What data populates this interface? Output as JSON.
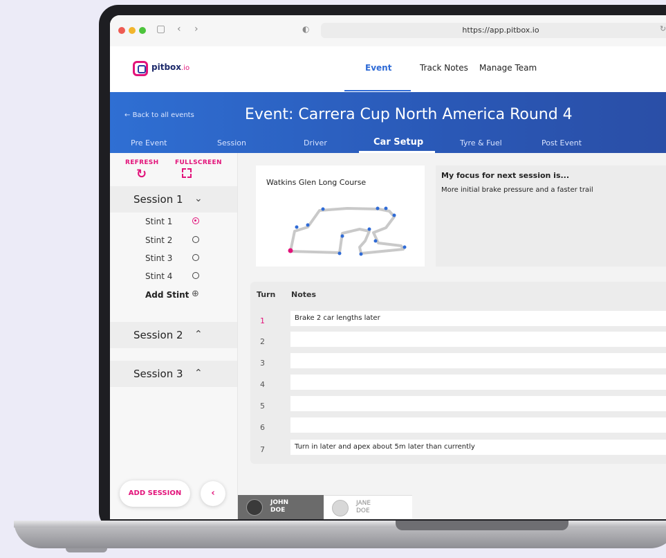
{
  "browser": {
    "url": "https://app.pitbox.io"
  },
  "app": {
    "brand": "pitbox",
    "brand_suffix": ".io"
  },
  "topnav": {
    "tabs": [
      "Event",
      "Track Notes",
      "Manage Team"
    ],
    "active": "Event"
  },
  "banner": {
    "back": "Back to all events",
    "title": "Event: Carrera Cup North America Round 4",
    "subtabs": [
      "Pre Event",
      "Session",
      "Driver",
      "Car Setup",
      "Tyre & Fuel",
      "Post Event"
    ],
    "active_subtab": "Car Setup"
  },
  "sidebar": {
    "refresh": "REFRESH",
    "fullscreen": "FULLSCREEN",
    "sessions": [
      "Session 1",
      "Session 2",
      "Session 3"
    ],
    "stints": [
      "Stint 1",
      "Stint 2",
      "Stint 3",
      "Stint 4"
    ],
    "selected_stint": "Stint 1",
    "add_stint": "Add Stint",
    "add_session": "ADD SESSION"
  },
  "track": {
    "name": "Watkins Glen Long Course"
  },
  "focus": {
    "title": "My focus for next session is...",
    "text": "More initial brake pressure and a faster trail"
  },
  "notes": {
    "headers": [
      "Turn",
      "Notes"
    ],
    "rows": [
      {
        "turn": "1",
        "note": "Brake 2 car lengths later"
      },
      {
        "turn": "2",
        "note": ""
      },
      {
        "turn": "3",
        "note": ""
      },
      {
        "turn": "4",
        "note": ""
      },
      {
        "turn": "5",
        "note": ""
      },
      {
        "turn": "6",
        "note": ""
      },
      {
        "turn": "7",
        "note": "Turn in later and apex about 5m later than currently"
      }
    ]
  },
  "drivers": [
    {
      "first": "JOHN",
      "last": "DOE",
      "active": true
    },
    {
      "first": "JANE",
      "last": "DOE",
      "active": false
    }
  ],
  "colors": {
    "accent": "#e2137a",
    "primary": "#2f6bd6"
  }
}
